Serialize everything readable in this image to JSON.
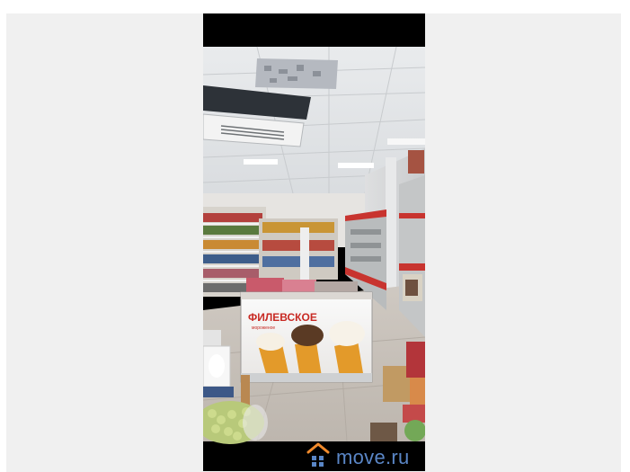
{
  "photo": {
    "freezer_brand": "ФИЛЕВСКОЕ",
    "freezer_tagline": "мороженое",
    "watermark": {
      "text": "move.ru",
      "icon": "house-icon",
      "color": "#5a86c6",
      "accent": "#f08a2c"
    }
  }
}
